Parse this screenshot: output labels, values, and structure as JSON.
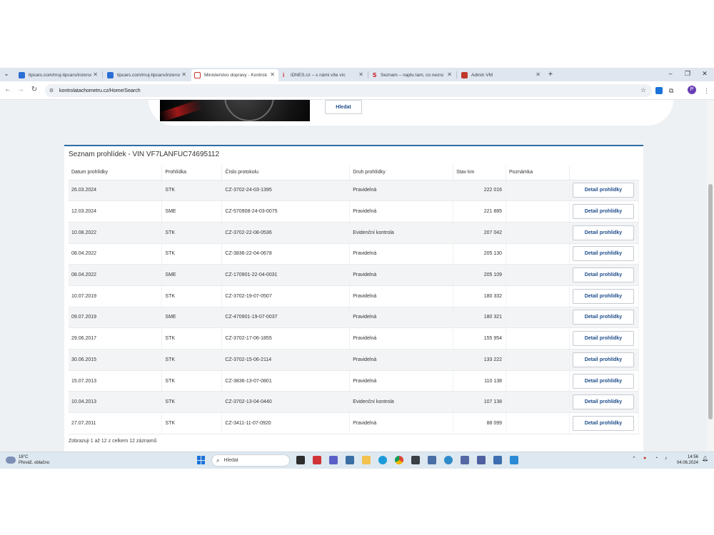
{
  "browser": {
    "tabs": [
      {
        "title": "tipcars.com/muj-tipcars/inzerce",
        "favicon_color": "#2b6fd6"
      },
      {
        "title": "tipcars.com/muj-tipcars/inzerce",
        "favicon_color": "#2b6fd6"
      },
      {
        "title": "Ministerstvo dopravy - Kontrola",
        "favicon_color": "#c0392b"
      },
      {
        "title": "iDNES.cz – s námi víte víc",
        "favicon_color": "#d62027"
      },
      {
        "title": "Seznam – najdu tam, co neznám",
        "favicon_color": "#cc0000"
      },
      {
        "title": "Admin VM",
        "favicon_color": "#c0392b"
      }
    ],
    "new_tab": "+",
    "window_controls": {
      "minimize": "–",
      "restore": "❐",
      "close": "✕"
    },
    "nav": {
      "back": "←",
      "forward": "→",
      "reload": "↻"
    },
    "url": "kontrolatachometru.cz/Home/Search",
    "profile_initial": "P"
  },
  "page": {
    "search_button_label": "Hledat",
    "results_title": "Seznam prohlídek - VIN VF7LANFUC74695112",
    "columns": [
      "Datum prohlídky",
      "Prohlídka",
      "Číslo protokolu",
      "Druh prohlídky",
      "Stav km",
      "Poznámka",
      ""
    ],
    "rows": [
      {
        "date": "26.03.2024",
        "type": "STK",
        "protocol": "CZ-3702-24-03-1395",
        "kind": "Pravidelná",
        "km": "222 016",
        "note": "",
        "action": "Detail prohlídky"
      },
      {
        "date": "12.03.2024",
        "type": "SME",
        "protocol": "CZ-570908-24-03-0075",
        "kind": "Pravidelná",
        "km": "221 885",
        "note": "",
        "action": "Detail prohlídky"
      },
      {
        "date": "10.08.2022",
        "type": "STK",
        "protocol": "CZ-3702-22-08-0536",
        "kind": "Evidenční kontrola",
        "km": "207 042",
        "note": "",
        "action": "Detail prohlídky"
      },
      {
        "date": "08.04.2022",
        "type": "STK",
        "protocol": "CZ-3836-22-04-0678",
        "kind": "Pravidelná",
        "km": "205 130",
        "note": "",
        "action": "Detail prohlídky"
      },
      {
        "date": "08.04.2022",
        "type": "SME",
        "protocol": "CZ-170901-22-04-0031",
        "kind": "Pravidelná",
        "km": "205 109",
        "note": "",
        "action": "Detail prohlídky"
      },
      {
        "date": "10.07.2019",
        "type": "STK",
        "protocol": "CZ-3702-19-07-0507",
        "kind": "Pravidelná",
        "km": "180 332",
        "note": "",
        "action": "Detail prohlídky"
      },
      {
        "date": "09.07.2019",
        "type": "SME",
        "protocol": "CZ-470901-19-07-0037",
        "kind": "Pravidelná",
        "km": "180 321",
        "note": "",
        "action": "Detail prohlídky"
      },
      {
        "date": "29.06.2017",
        "type": "STK",
        "protocol": "CZ-3702-17-06-1855",
        "kind": "Pravidelná",
        "km": "155 954",
        "note": "",
        "action": "Detail prohlídky"
      },
      {
        "date": "30.06.2015",
        "type": "STK",
        "protocol": "CZ-3702-15-06-2114",
        "kind": "Pravidelná",
        "km": "133 222",
        "note": "",
        "action": "Detail prohlídky"
      },
      {
        "date": "15.07.2013",
        "type": "STK",
        "protocol": "CZ-3836-13-07-0801",
        "kind": "Pravidelná",
        "km": "110 138",
        "note": "",
        "action": "Detail prohlídky"
      },
      {
        "date": "10.04.2013",
        "type": "STK",
        "protocol": "CZ-3702-13-04-0440",
        "kind": "Evidenční kontrola",
        "km": "107 138",
        "note": "",
        "action": "Detail prohlídky"
      },
      {
        "date": "27.07.2011",
        "type": "STK",
        "protocol": "CZ-3411-11-07-0920",
        "kind": "Pravidelná",
        "km": "88 099",
        "note": "",
        "action": "Detail prohlídky"
      }
    ],
    "footer": "Zobrazuji 1 až 12 z celkem 12 záznamů"
  },
  "taskbar": {
    "weather_temp": "18°C",
    "weather_desc": "Převáž. oblačno",
    "search_placeholder": "Hledat",
    "time": "14:56",
    "date": "04.06.2024"
  },
  "colors": {
    "accent": "#2c6ea5",
    "button_text": "#1f4e8c"
  }
}
